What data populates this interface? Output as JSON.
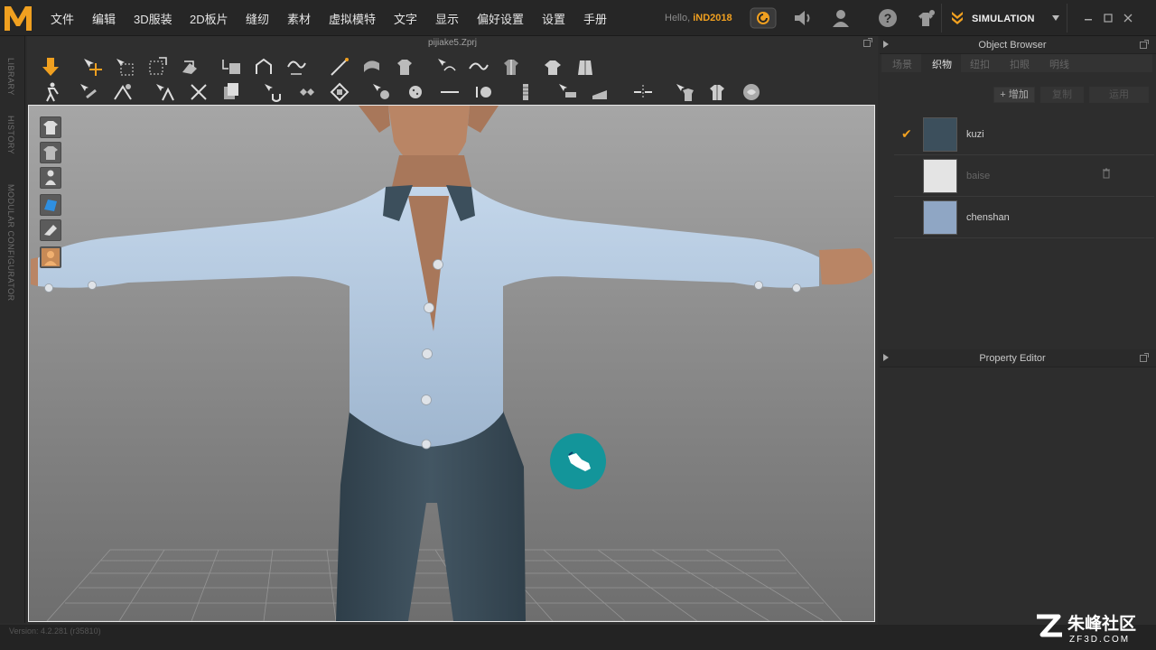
{
  "menu": {
    "items": [
      "文件",
      "编辑",
      "3D服装",
      "2D板片",
      "缝纫",
      "素材",
      "虚拟模特",
      "文字",
      "显示",
      "偏好设置",
      "设置",
      "手册"
    ],
    "hello_prefix": "Hello,",
    "user": "iND2018",
    "mode": "SIMULATION"
  },
  "left_tabs": [
    "LIBRARY",
    "HISTORY",
    "MODULAR CONFIGURATOR"
  ],
  "viewport": {
    "file_title": "pijiake5.Zprj"
  },
  "object_browser": {
    "title": "Object Browser",
    "tabs": [
      "场景",
      "织物",
      "纽扣",
      "扣眼",
      "明线"
    ],
    "active_tab": 1,
    "add_label": "+ 增加",
    "copy_label": "复制",
    "apply_label": "运用",
    "fabrics": [
      {
        "name": "kuzi",
        "color": "#3c4f5c",
        "checked": true,
        "dim": false
      },
      {
        "name": "baise",
        "color": "#e4e4e4",
        "checked": false,
        "dim": true
      },
      {
        "name": "chenshan",
        "color": "#8fa6c4",
        "checked": false,
        "dim": false
      }
    ]
  },
  "property_editor": {
    "title": "Property Editor"
  },
  "version": "Version: 4.2.281 (r35810)",
  "watermark": {
    "name": "朱峰社区",
    "domain": "ZF3D.COM"
  },
  "colors": {
    "accent": "#f0a020",
    "shirt": "#b4cbe2",
    "pants": "#3c4f5c",
    "skin": "#b98565",
    "cursor": "#13959a"
  }
}
